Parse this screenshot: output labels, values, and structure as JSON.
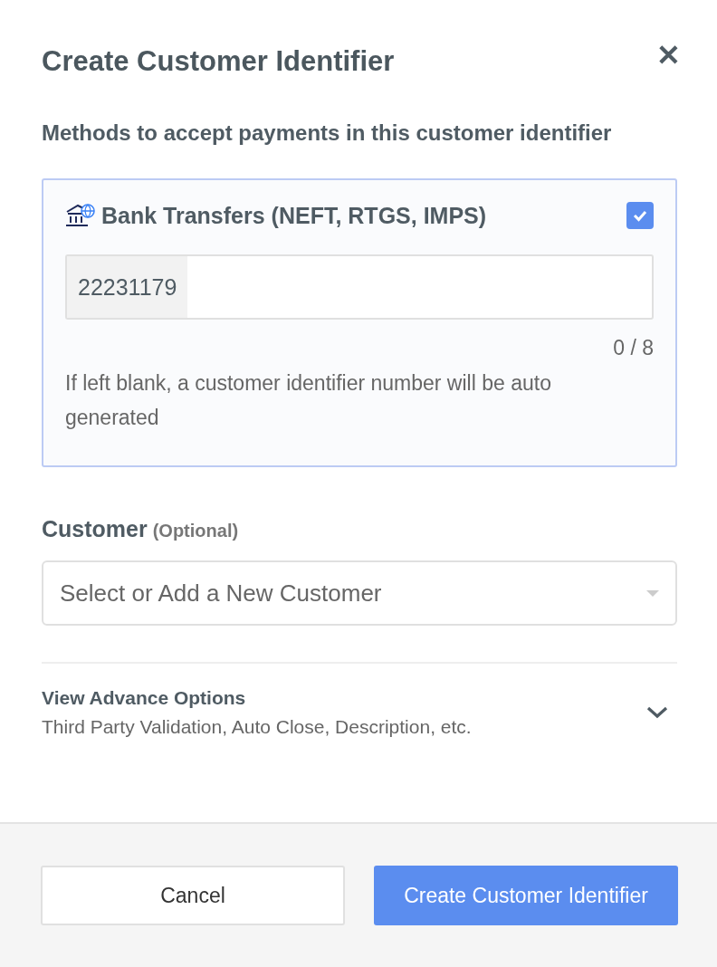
{
  "dialog": {
    "title": "Create Customer Identifier",
    "close": "✕"
  },
  "methods": {
    "heading": "Methods to accept payments in this customer identifier",
    "items": [
      {
        "label": "Bank Transfers (NEFT, RTGS, IMPS)",
        "checked": true,
        "prefix": "22231179",
        "counter": "0 / 8",
        "hint": "If left blank, a customer identifier number will be auto generated"
      }
    ]
  },
  "customer": {
    "label": "Customer",
    "note": "(Optional)",
    "placeholder": "Select or Add a New Customer"
  },
  "advance_options": {
    "title": "View Advance Options",
    "subtitle": "Third Party Validation, Auto Close, Description, etc.",
    "expanded": false
  },
  "buttons": [
    {
      "label": "Cancel",
      "kind": "secondary"
    },
    {
      "label": "Create Customer Identifier",
      "kind": "primary"
    }
  ]
}
